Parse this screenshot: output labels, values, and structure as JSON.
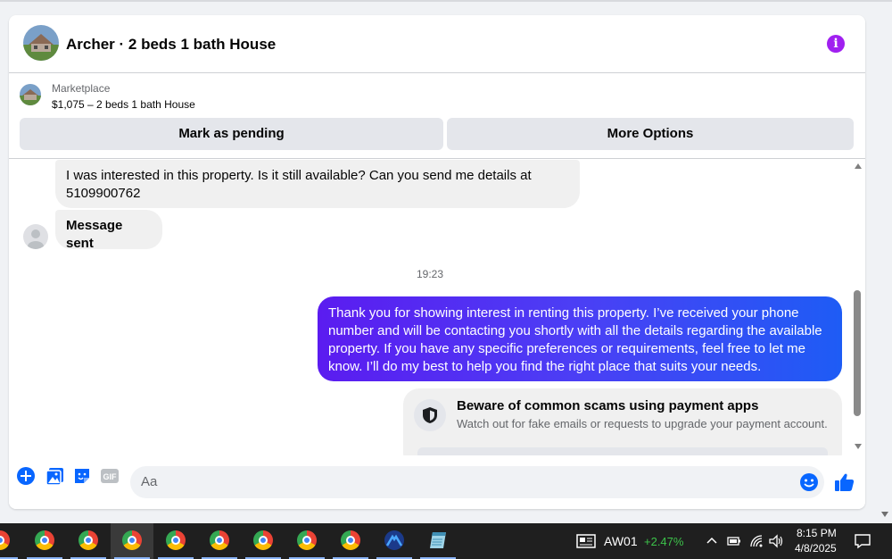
{
  "header": {
    "title": "Archer · 2 beds 1 bath House",
    "info_icon": "i"
  },
  "listing": {
    "source_label": "Marketplace",
    "price_summary": "$1,075 – 2 beds 1 bath House",
    "mark_pending_label": "Mark as pending",
    "more_options_label": "More Options"
  },
  "messages": {
    "incoming_1": "I was interested in this property. Is it still available? Can you send me details at 5109900762",
    "incoming_2": "Message sent",
    "timestamp": "19:23",
    "outgoing_1": "Thank you for showing interest in renting this property. I’ve received your phone number and will be contacting you shortly with all the details regarding the available property. If you have any specific preferences or requirements, feel free to let me know. I’ll do my best to help you find the right place that suits your needs.",
    "scam_title": "Beware of common scams using payment apps",
    "scam_subtitle": "Watch out for fake emails or requests to upgrade your payment account."
  },
  "composer": {
    "placeholder": "Aa"
  },
  "taskbar": {
    "stock_symbol": "AW01",
    "stock_change": "+2.47%",
    "time": "8:15 PM",
    "date": "4/8/2025"
  },
  "colors": {
    "accent": "#0866ff",
    "info": "#a020f0",
    "stock_up": "#3cc24a"
  }
}
